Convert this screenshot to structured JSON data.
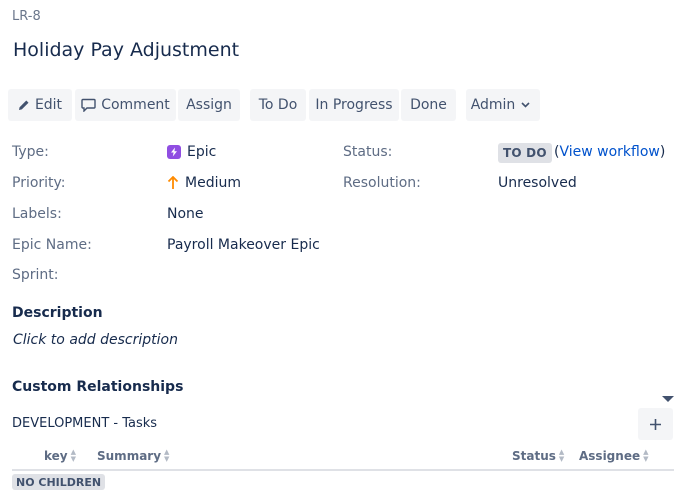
{
  "issue": {
    "key": "LR-8",
    "title": "Holiday Pay Adjustment"
  },
  "toolbar": {
    "edit_label": "Edit",
    "comment_label": "Comment",
    "assign_label": "Assign",
    "todo_label": "To Do",
    "inprogress_label": "In Progress",
    "done_label": "Done",
    "admin_label": "Admin"
  },
  "details": {
    "type_label": "Type:",
    "type_value": "Epic",
    "priority_label": "Priority:",
    "priority_value": "Medium",
    "labels_label": "Labels:",
    "labels_value": "None",
    "epic_name_label": "Epic Name:",
    "epic_name_value": "Payroll Makeover Epic",
    "sprint_label": "Sprint:",
    "status_label": "Status:",
    "status_value": "TO DO",
    "view_workflow_label": "View workflow",
    "resolution_label": "Resolution:",
    "resolution_value": "Unresolved"
  },
  "description": {
    "heading": "Description",
    "placeholder": "Click to add description"
  },
  "custom_relationships": {
    "heading": "Custom Relationships",
    "development_title": "DEVELOPMENT - Tasks",
    "columns": [
      "key",
      "Summary",
      "Status",
      "Assignee"
    ],
    "empty_label": "NO CHILDREN"
  },
  "colors": {
    "epic": "#904ee2",
    "priority_medium": "#ff8b00",
    "link": "#0052cc",
    "button_bg": "#f4f5f7"
  },
  "icons": {
    "edit": "pencil-icon",
    "comment": "speech-bubble-icon",
    "admin_caret": "chevron-down-icon",
    "epic": "lightning-icon",
    "priority": "arrow-up-icon",
    "add": "plus-icon"
  }
}
